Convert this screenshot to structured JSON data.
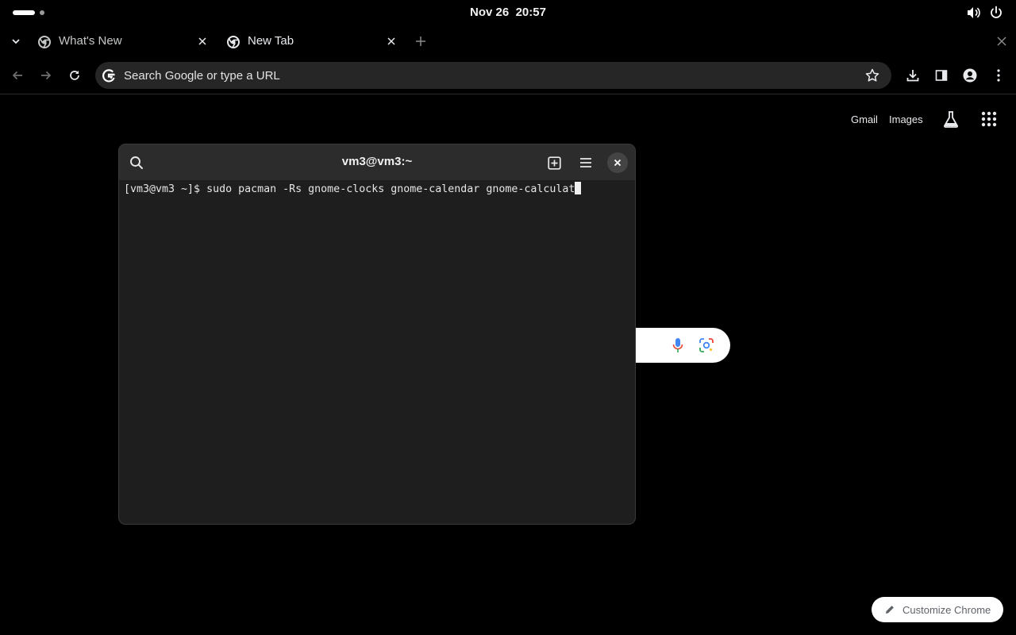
{
  "topbar": {
    "clock": "Nov 26  20:57"
  },
  "chrome": {
    "tabs": [
      {
        "title": "What's New",
        "active": false
      },
      {
        "title": "New Tab",
        "active": true
      }
    ],
    "omnibox": {
      "placeholder": "Search Google or type a URL",
      "value": ""
    }
  },
  "ntp": {
    "links": {
      "gmail": "Gmail",
      "images": "Images"
    },
    "customize_label": "Customize Chrome"
  },
  "terminal": {
    "title": "vm3@vm3:~",
    "prompt": "[vm3@vm3 ~]$ ",
    "command": "sudo pacman -Rs gnome-clocks gnome-calendar gnome-calculat"
  },
  "colors": {
    "google_blue": "#4285f4",
    "google_red": "#ea4335",
    "google_yellow": "#fbbc05",
    "google_green": "#34a853"
  }
}
